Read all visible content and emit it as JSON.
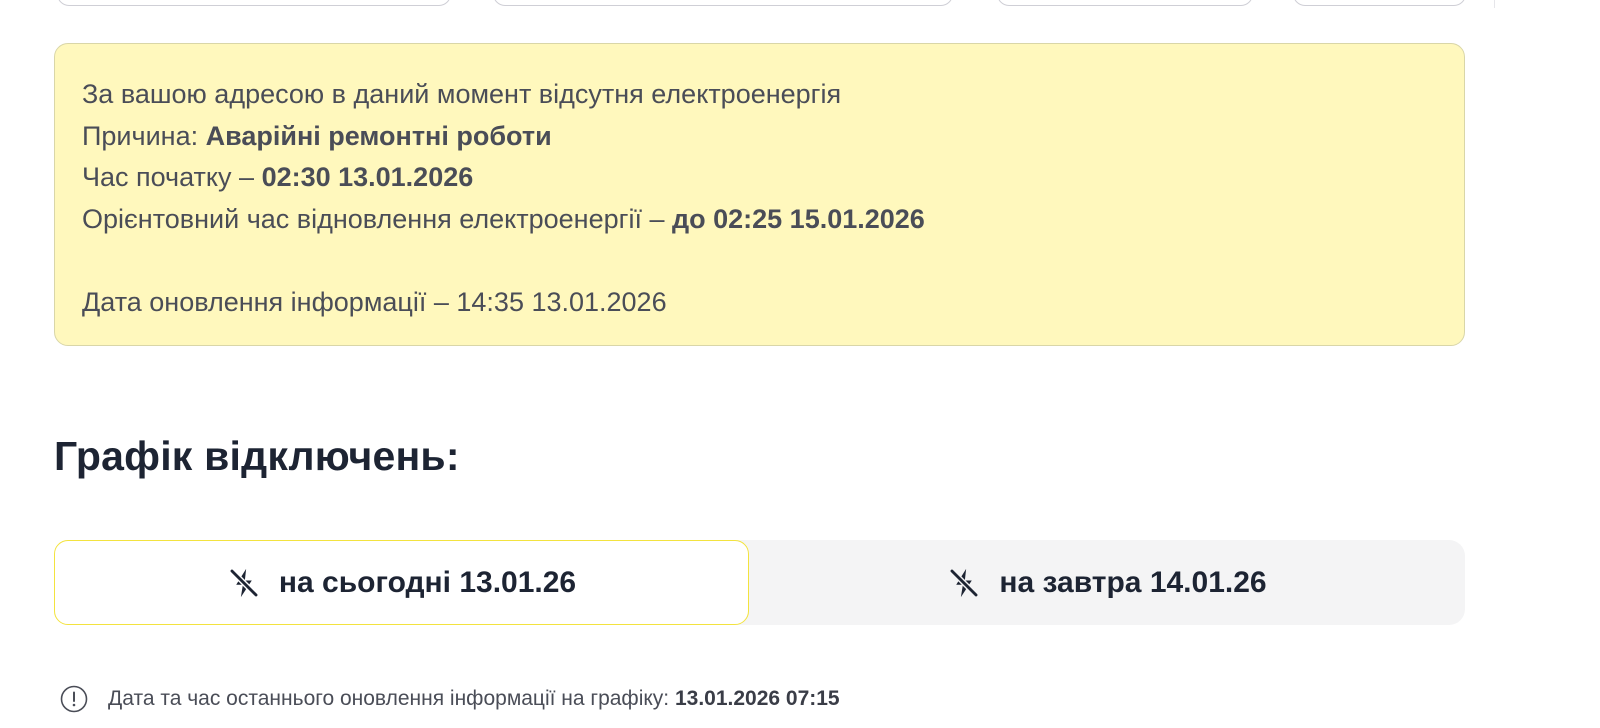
{
  "notice": {
    "line1": "За вашою адресою в даний момент відсутня електроенергія",
    "reason_label": "Причина: ",
    "reason_value": "Аварійні ремонтні роботи",
    "start_label": "Час початку – ",
    "start_value": "02:30 13.01.2026",
    "restore_label": "Орієнтовний час відновлення електроенергії – ",
    "restore_value": "до 02:25 15.01.2026",
    "updated_label": "Дата оновлення інформації – 14:35 13.01.2026"
  },
  "schedule": {
    "title": "Графік відключень:",
    "tabs": [
      {
        "label": "на сьогодні 13.01.26",
        "icon": "power-off-icon",
        "active": true
      },
      {
        "label": "на завтра 14.01.26",
        "icon": "power-off-icon",
        "active": false
      }
    ]
  },
  "footer": {
    "label": "Дата та час останнього оновлення інформації на графіку: ",
    "value": "13.01.2026 07:15",
    "icon": "info-icon"
  },
  "colors": {
    "notice_bg": "#fff8bd",
    "active_tab_border": "#f3e33f",
    "tabs_bg": "#f4f4f5",
    "title": "#1d2433"
  }
}
